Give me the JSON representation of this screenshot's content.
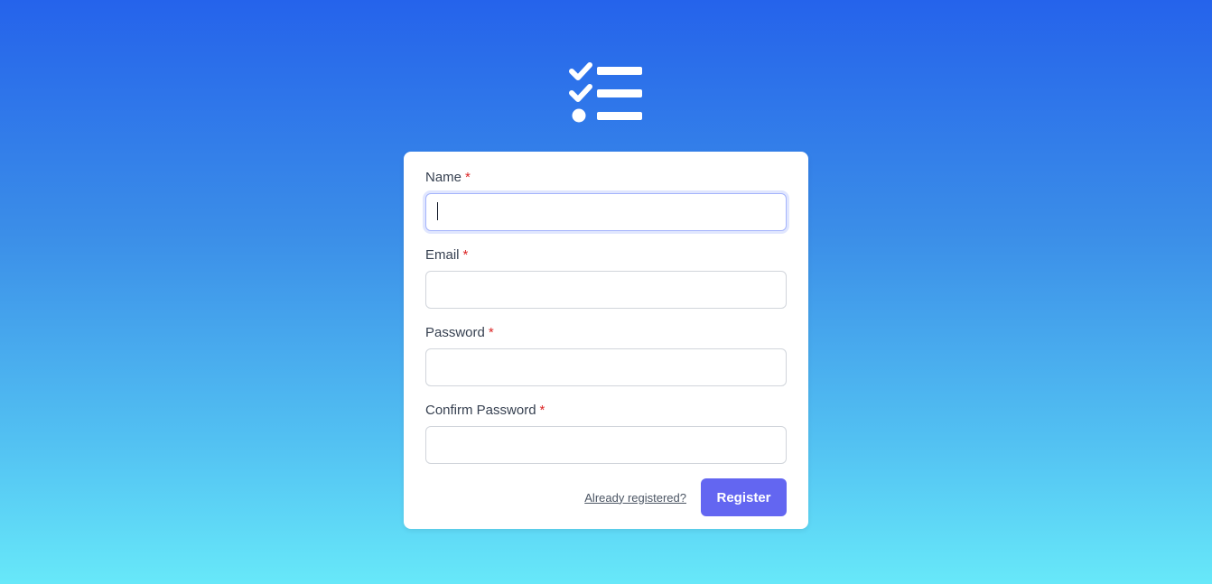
{
  "form": {
    "fields": [
      {
        "label": "Name",
        "required_mark": "*",
        "value": ""
      },
      {
        "label": "Email",
        "required_mark": "*",
        "value": ""
      },
      {
        "label": "Password",
        "required_mark": "*",
        "value": ""
      },
      {
        "label": "Confirm Password",
        "required_mark": "*",
        "value": ""
      }
    ],
    "login_link": "Already registered?",
    "submit_label": "Register"
  },
  "logo": {
    "icon": "checklist-icon"
  },
  "colors": {
    "accent": "#6366f1",
    "required": "#dc2626",
    "gradient_top": "#2563eb",
    "gradient_bottom": "#67e8f9"
  }
}
